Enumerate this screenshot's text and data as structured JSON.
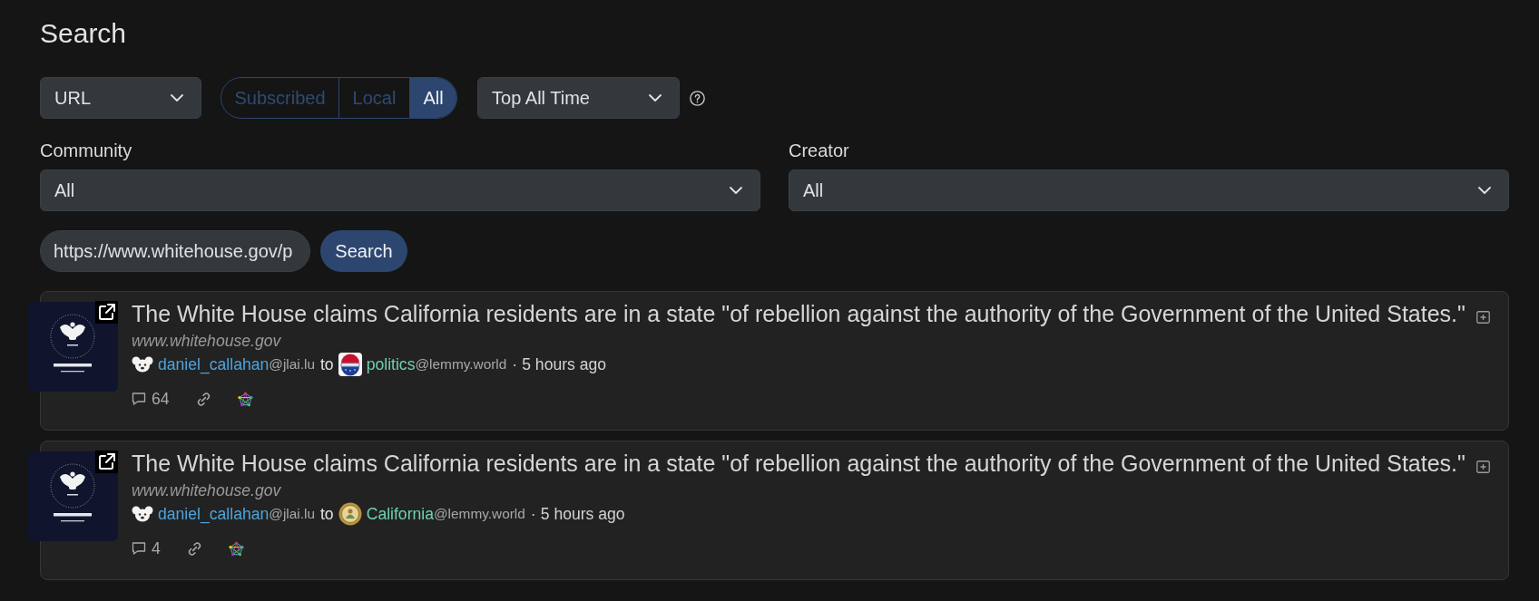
{
  "page": {
    "title": "Search"
  },
  "filters": {
    "type_select": {
      "value": "URL"
    },
    "listing_tabs": [
      {
        "label": "Subscribed",
        "selected": false
      },
      {
        "label": "Local",
        "selected": false
      },
      {
        "label": "All",
        "selected": true
      }
    ],
    "sort_select": {
      "value": "Top All Time"
    }
  },
  "selectors": [
    {
      "label": "Community",
      "value": "All"
    },
    {
      "label": "Creator",
      "value": "All"
    }
  ],
  "search": {
    "value": "https://www.whitehouse.gov/p",
    "button": "Search"
  },
  "posts": [
    {
      "title": "The White House claims California residents are in a state \"of rebellion against the authority of the Government of the United States.\"",
      "domain": "www.whitehouse.gov",
      "author": "daniel_callahan",
      "author_instance": "@jlai.lu",
      "connector": "to",
      "community": "politics",
      "community_instance": "@lemmy.world",
      "separator": "·",
      "time": "5 hours ago",
      "comments": "64"
    },
    {
      "title": "The White House claims California residents are in a state \"of rebellion against the authority of the Government of the United States.\"",
      "domain": "www.whitehouse.gov",
      "author": "daniel_callahan",
      "author_instance": "@jlai.lu",
      "connector": "to",
      "community": "California",
      "community_instance": "@lemmy.world",
      "separator": "·",
      "time": "5 hours ago",
      "comments": "4"
    }
  ]
}
